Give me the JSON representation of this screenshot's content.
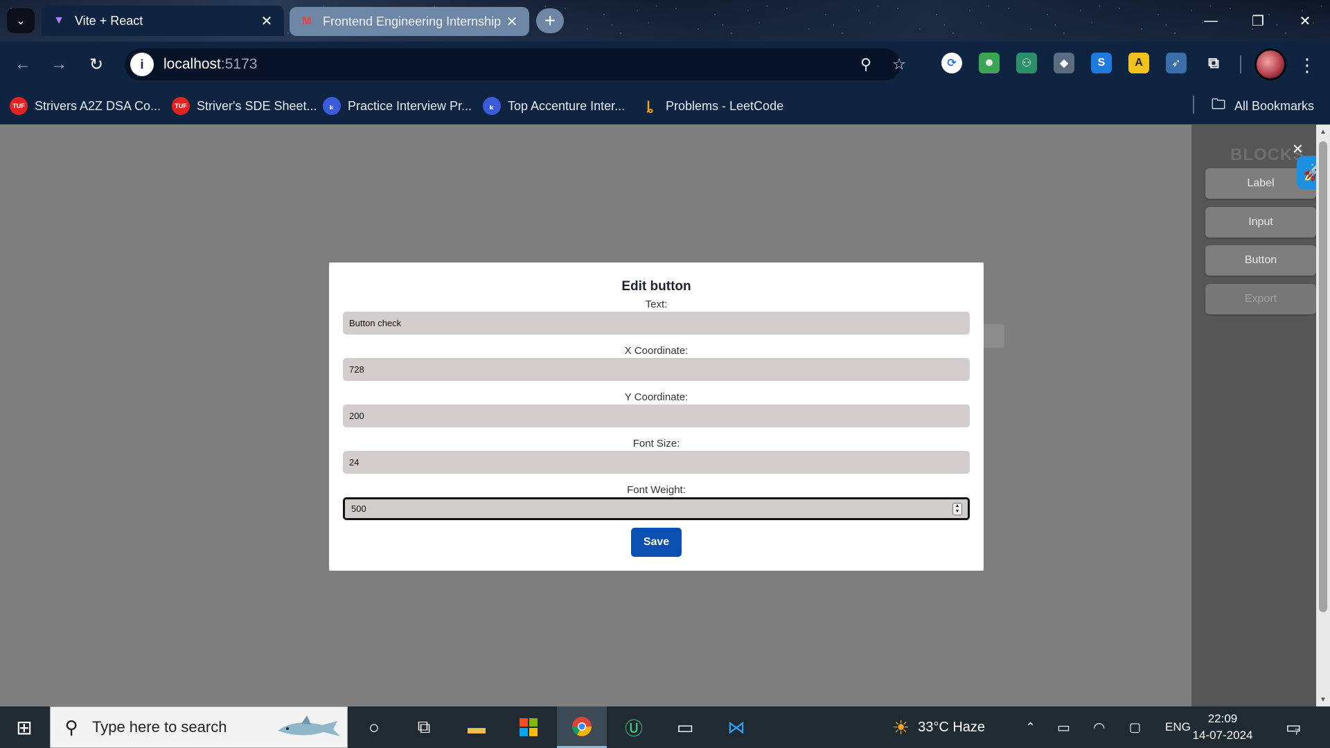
{
  "browser": {
    "tabs": [
      {
        "title": "Vite + React",
        "active": true
      },
      {
        "title": "Frontend Engineering Internship",
        "active": false
      }
    ],
    "close_glyph": "✕",
    "new_tab_glyph": "+",
    "url_host": "localhost",
    "url_port": ":5173",
    "bookmarks": [
      {
        "label": "Strivers A2Z DSA Co...",
        "icon": "tuf-icon",
        "color": "#e02424"
      },
      {
        "label": "Striver's SDE Sheet...",
        "icon": "tuf-icon",
        "color": "#e02424"
      },
      {
        "label": "Practice Interview Pr...",
        "icon": "kodnest-icon",
        "color": "#3b5bdb"
      },
      {
        "label": "Top Accenture Inter...",
        "icon": "kodnest-icon",
        "color": "#3b5bdb"
      },
      {
        "label": "Problems - LeetCode",
        "icon": "leetcode-icon",
        "color": "#f2a11b"
      }
    ],
    "all_bookmarks_label": "All Bookmarks",
    "tuf_badge": "TUF"
  },
  "sidebar": {
    "title": "BLOCKS",
    "close_glyph": "✕",
    "blocks": [
      "Label",
      "Input",
      "Button"
    ],
    "export_label": "Export"
  },
  "modal": {
    "title": "Edit button",
    "fields": [
      {
        "label": "Text:",
        "value": "Button check"
      },
      {
        "label": "X Coordinate:",
        "value": "728"
      },
      {
        "label": "Y Coordinate:",
        "value": "200"
      },
      {
        "label": "Font Size:",
        "value": "24"
      },
      {
        "label": "Font Weight:",
        "value": "500"
      }
    ],
    "save_label": "Save"
  },
  "taskbar": {
    "search_placeholder": "Type here to search",
    "weather_text": "33°C  Haze",
    "language": "ENG",
    "time": "22:09",
    "date": "14-07-2024",
    "notification_count": "7"
  },
  "colors": {
    "browser_chrome": "#0f2441",
    "modal_field_bg": "#d3cccc",
    "save_button": "#0b4fb0",
    "sidebar_bg": "#565656",
    "page_overlay": "#7f7f7f"
  }
}
